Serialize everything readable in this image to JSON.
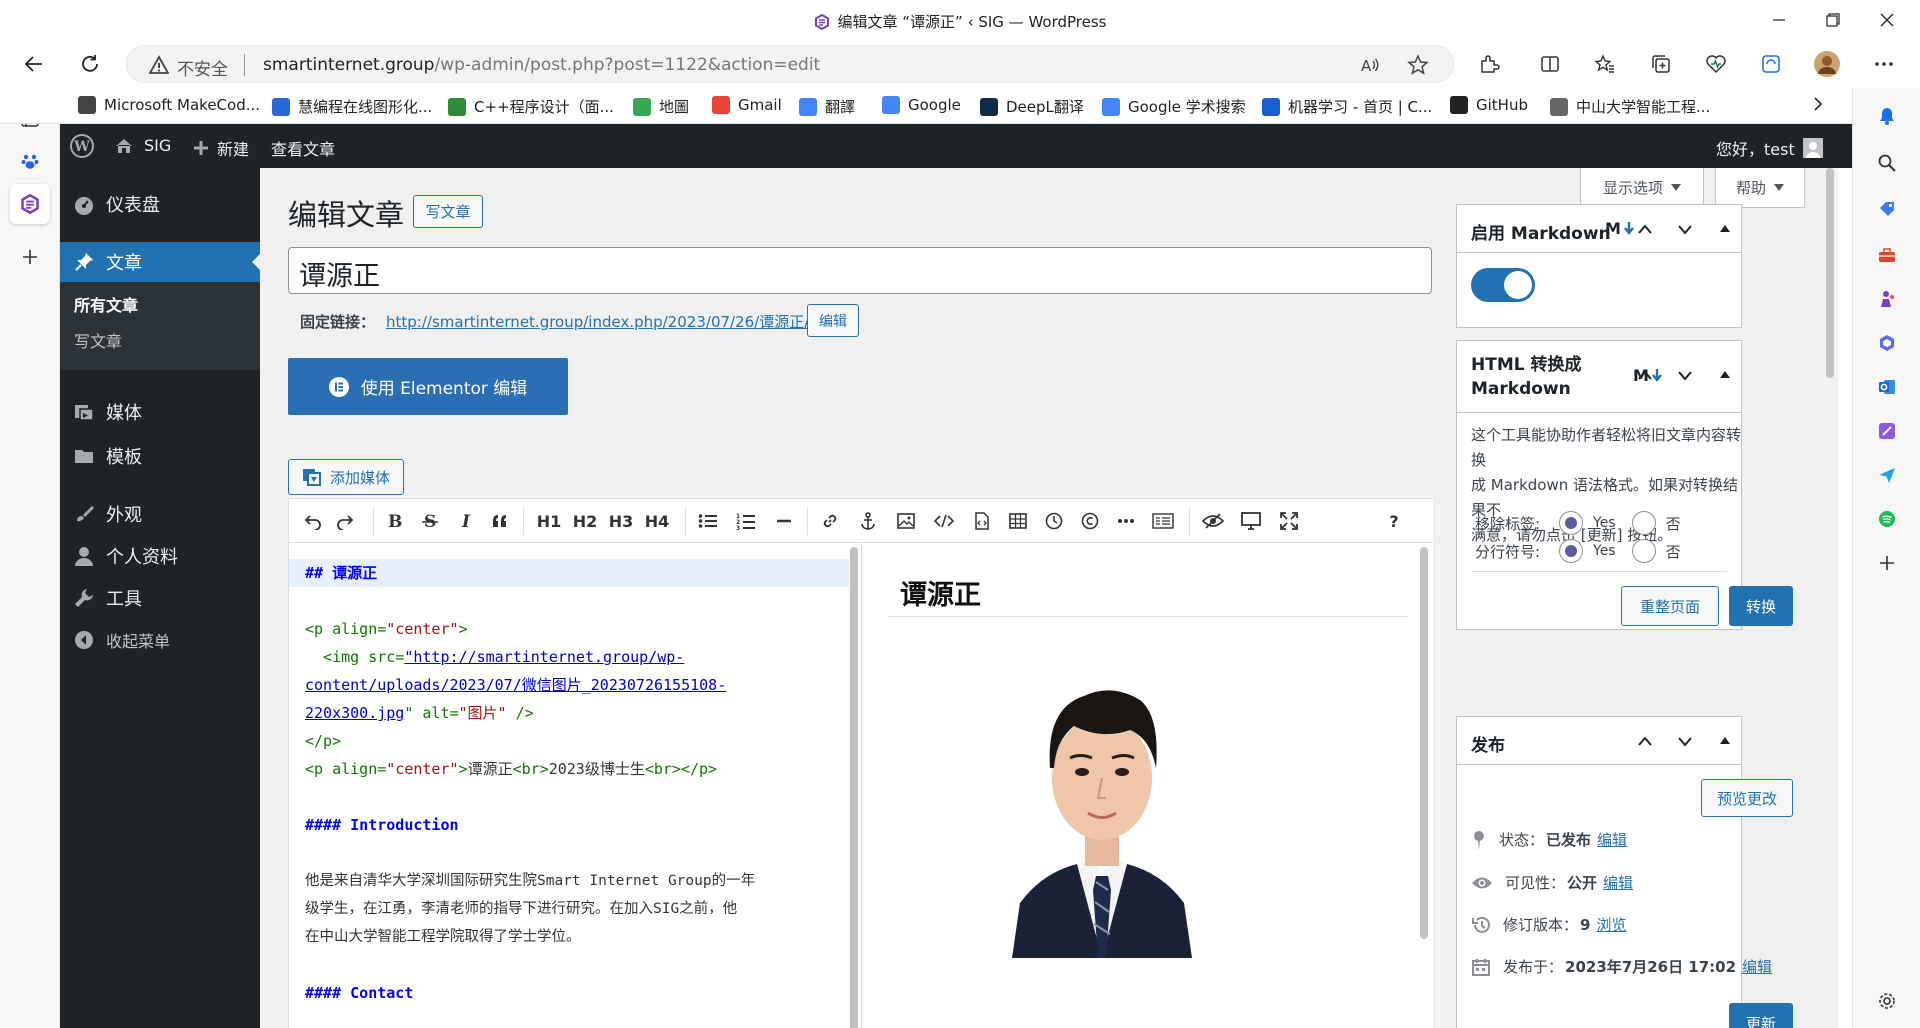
{
  "window": {
    "title": "编辑文章 “谭源正” ‹ SIG — WordPress"
  },
  "browser": {
    "security_label": "不安全",
    "url_host": "smartinternet.group",
    "url_path": "/wp-admin/post.php?post=1122&action=edit"
  },
  "bookmarks": [
    {
      "label": "Microsoft MakeCod...",
      "color": "#444"
    },
    {
      "label": "慧编程在线图形化...",
      "color": "#2a6ad8"
    },
    {
      "label": "C++程序设计（面...",
      "color": "#2d8b3a"
    },
    {
      "label": "地圖",
      "color": "#34a853"
    },
    {
      "label": "Gmail",
      "color": "#ea4335"
    },
    {
      "label": "翻譯",
      "color": "#4285f4"
    },
    {
      "label": "Google",
      "color": "#4285f4"
    },
    {
      "label": "DeepL翻译",
      "color": "#0f2b46"
    },
    {
      "label": "Google 学术搜索",
      "color": "#4285f4"
    },
    {
      "label": "机器学习 - 首页 | C...",
      "color": "#1a5fd0"
    },
    {
      "label": "GitHub",
      "color": "#222"
    },
    {
      "label": "中山大学智能工程...",
      "color": "#666"
    }
  ],
  "adminbar": {
    "site": "SIG",
    "new": "新建",
    "view": "查看文章",
    "greeting": "您好，test"
  },
  "menu": {
    "dashboard": "仪表盘",
    "posts": "文章",
    "all_posts": "所有文章",
    "write_post": "写文章",
    "media": "媒体",
    "templates": "模板",
    "appearance": "外观",
    "profile": "个人资料",
    "tools": "工具",
    "collapse": "收起菜单"
  },
  "screen": {
    "options": "显示选项",
    "help": "帮助"
  },
  "page": {
    "heading": "编辑文章",
    "add_new": "写文章",
    "post_title": "谭源正",
    "permalink_label": "固定链接：",
    "permalink_url": "http://smartinternet.group/index.php/2023/07/26/谭源正/",
    "permalink_edit": "编辑",
    "elementor_button": "使用 Elementor 编辑",
    "add_media": "添加媒体"
  },
  "toolbar": {
    "h1": "H1",
    "h2": "H2",
    "h3": "H3",
    "h4": "H4",
    "help": "?"
  },
  "code": {
    "line1": "## 谭源正",
    "line3_open": "<p align=",
    "line3_val": "\"center\"",
    "line3_close": ">",
    "line4_tag": "  <img src=",
    "line4_url": "\"http://smartinternet.group/wp-",
    "line5_url": "content/uploads/2023/07/微信图片_20230726155108-",
    "line6_url": "220x300.jpg",
    "line6_rest": "\" alt=",
    "line6_alt": "\"图片\"",
    "line6_end": " />",
    "line7": "</p>",
    "line8_open": "<p align=",
    "line8_val": "\"center\"",
    "line8_gt": ">",
    "line8_text1": "谭源正",
    "line8_br1": "<br>",
    "line8_text2": "2023级博士生",
    "line8_br2": "<br></p>",
    "line10": "#### Introduction",
    "line12": "他是来自清华大学深圳国际研究生院Smart Internet Group的一年",
    "line13": "级学生，在江勇，李清老师的指导下进行研究。在加入SIG之前，他",
    "line14": "在中山大学智能工程学院取得了学士学位。",
    "line16": "#### Contact"
  },
  "preview": {
    "heading": "谭源正"
  },
  "markdown_box": {
    "title": "启用 Markdown",
    "toggle_on": true
  },
  "html2md_box": {
    "title_line1": "HTML 转换成",
    "title_line2": "Markdown",
    "desc1": "这个工具能协助作者轻松将旧文章内容转换",
    "desc2": "成 Markdown 语法格式。如果对转换结果不",
    "desc3": "满意，请勿点击 [更新] 按钮。",
    "remove_tags_label": "移除标签:",
    "line_break_label": "分行符号:",
    "yes": "Yes",
    "no": "否",
    "reset_button": "重整页面",
    "convert_button": "转换"
  },
  "publish_box": {
    "title": "发布",
    "preview_button": "预览更改",
    "status_label": "状态：",
    "status_value": "已发布",
    "visibility_label": "可见性：",
    "visibility_value": "公开",
    "revisions_label": "修订版本：",
    "revisions_value": "9",
    "browse": "浏览",
    "published_label": "发布于：",
    "published_value": "2023年7月26日 17:02",
    "edit": "编辑",
    "update_button": "更新"
  },
  "colors": {
    "wp_dark": "#1d2327",
    "wp_blue": "#2271b1",
    "elementor_blue": "#2a6fb3"
  }
}
